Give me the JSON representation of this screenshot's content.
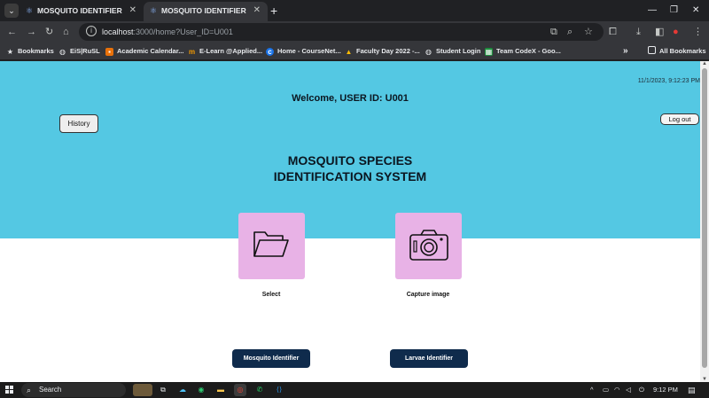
{
  "browser": {
    "tabs": [
      {
        "title": "MOSQUITO IDENTIFIER",
        "active": false
      },
      {
        "title": "MOSQUITO IDENTIFIER",
        "active": true
      }
    ],
    "new_tab_label": "+",
    "url_host": "localhost",
    "url_rest": ":3000/home?User_ID=U001",
    "bookmarks": [
      {
        "label": "Bookmarks",
        "icon": "star-icon"
      },
      {
        "label": "EiS|RuSL",
        "icon": "globe-icon"
      },
      {
        "label": "Academic Calendar...",
        "icon": "calendar-icon"
      },
      {
        "label": "E-Learn @Applied...",
        "icon": "moodle-icon"
      },
      {
        "label": "Home - CourseNet...",
        "icon": "coursenet-icon"
      },
      {
        "label": "Faculty Day 2022 -...",
        "icon": "drive-icon"
      },
      {
        "label": "Student Login",
        "icon": "globe-icon"
      },
      {
        "label": "Team CodeX - Goo...",
        "icon": "sheets-icon"
      }
    ],
    "all_bookmarks_label": "All Bookmarks",
    "more_label": "»"
  },
  "app": {
    "timestamp": "11/1/2023, 9:12:23 PM",
    "welcome": "Welcome, USER ID: U001",
    "history_label": "History",
    "logout_label": "Log out",
    "title_line1": "MOSQUITO SPECIES",
    "title_line2": "IDENTIFICATION SYSTEM",
    "tiles": [
      {
        "label": "Select",
        "icon": "folder-icon"
      },
      {
        "label": "Capture image",
        "icon": "camera-icon"
      }
    ],
    "buttons": {
      "mosquito": "Mosquito Identifier",
      "larvae": "Larvae Identifier"
    },
    "colors": {
      "hero": "#54c8e3",
      "tile": "#e8b2e6",
      "dark_button": "#0f2b4c"
    }
  },
  "taskbar": {
    "search_label": "Search",
    "time": "9:12 PM"
  }
}
